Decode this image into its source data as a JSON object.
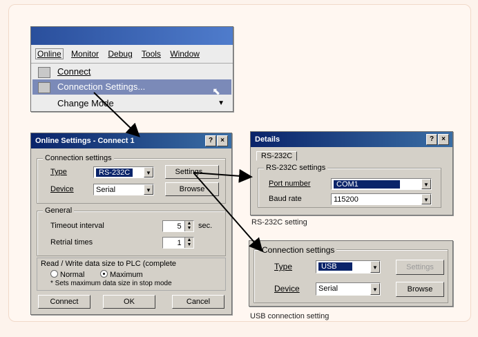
{
  "menu_window": {
    "menubar": [
      "Online",
      "Monitor",
      "Debug",
      "Tools",
      "Window"
    ],
    "items": [
      "Connect",
      "Connection Settings...",
      "Change Mode"
    ],
    "highlighted_index": 1
  },
  "online_dialog": {
    "title": "Online Settings - Connect 1",
    "help_btn": "?",
    "close_btn": "×",
    "conn_group": "Connection settings",
    "type_label": "Type",
    "type_value": "RS-232C",
    "device_label": "Device",
    "device_value": "Serial",
    "settings_btn": "Settings...",
    "browse_btn": "Browse",
    "general_group": "General",
    "timeout_label": "Timeout interval",
    "timeout_value": "5",
    "timeout_unit": "sec.",
    "retries_label": "Retrial times",
    "retries_value": "1",
    "rw_label": "Read / Write data size to PLC (complete",
    "normal_label": "Normal",
    "maximum_label": "Maximum",
    "rw_note": "* Sets maximum data size in stop mode",
    "connect_btn": "Connect",
    "ok_btn": "OK",
    "cancel_btn": "Cancel"
  },
  "details_dialog": {
    "title": "Details",
    "help_btn": "?",
    "close_btn": "×",
    "tab": "RS-232C",
    "group": "RS-232C settings",
    "port_label": "Port number",
    "port_value": "COM1",
    "baud_label": "Baud rate",
    "baud_value": "115200"
  },
  "usb_panel": {
    "group": "Connection settings",
    "type_label": "Type",
    "type_value": "USB",
    "device_label": "Device",
    "device_value": "Serial",
    "settings_btn": "Settings",
    "browse_btn": "Browse"
  },
  "captions": {
    "rs232c": "RS-232C setting",
    "usb": "USB connection setting"
  }
}
